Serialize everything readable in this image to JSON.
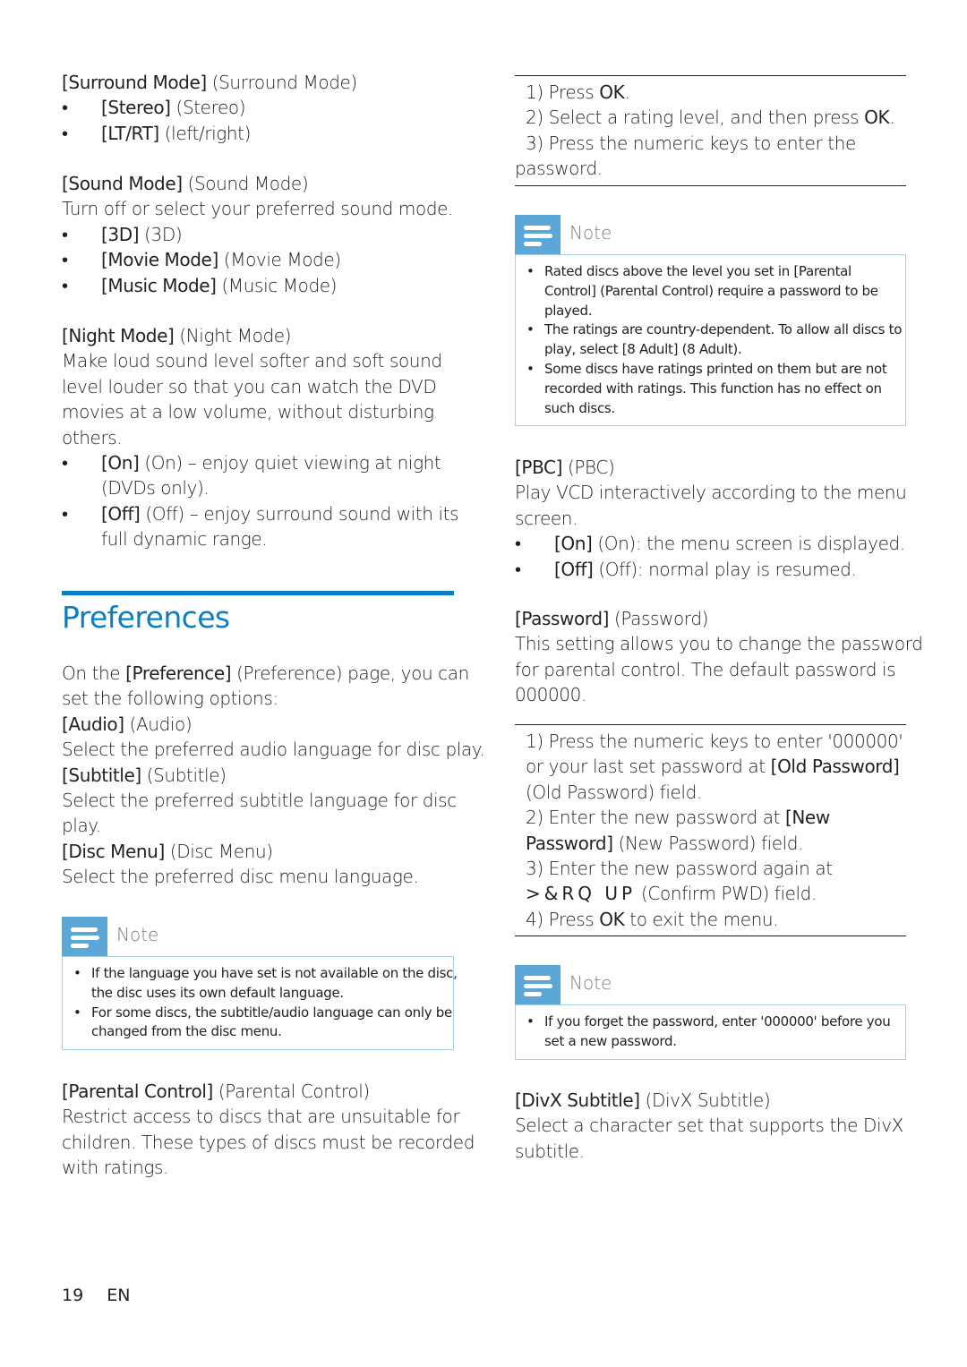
{
  "left": {
    "surround": {
      "label": "[Surround Mode]",
      "desc": " (Surround Mode)",
      "options": [
        {
          "label": "[Stereo]",
          "desc": " (Stereo)"
        },
        {
          "label": "[LT/RT]",
          "desc": " (left/right)"
        }
      ]
    },
    "sound": {
      "label": "[Sound Mode]",
      "desc": " (Sound Mode)",
      "text": "Turn off or select your preferred sound mode.",
      "options": [
        {
          "label": "[3D]",
          "desc": " (3D)"
        },
        {
          "label": "[Movie Mode]",
          "desc": " (Movie Mode)"
        },
        {
          "label": "[Music Mode]",
          "desc": " (Music Mode)"
        }
      ]
    },
    "night": {
      "label": "[Night Mode]",
      "desc": " (Night Mode)",
      "text_lines": [
        "Make loud sound level softer and soft sound",
        "level louder so that you can watch the DVD",
        "movies at a low volume, without disturbing",
        "others."
      ],
      "options": [
        {
          "label": "[On]",
          "desc": " (On) – enjoy quiet viewing at night",
          "desc2": "(DVDs only)."
        },
        {
          "label": "[Off]",
          "desc": " (Off) – enjoy surround sound with its",
          "desc2": "full dynamic range."
        }
      ]
    },
    "preferences": {
      "heading": "Preferences",
      "intro_pre": "On the ",
      "intro_bold": "[Preference]",
      "intro_post": " (Preference) page, you can",
      "intro_line2": "set the following options:",
      "audio": {
        "label": "[Audio]",
        "desc": " (Audio)",
        "text": "Select the preferred audio language for disc play."
      },
      "subtitle": {
        "label": "[Subtitle]",
        "desc": " (Subtitle)",
        "text1": "Select the preferred subtitle language for disc",
        "text2": "play."
      },
      "disc_menu": {
        "label": "[Disc Menu]",
        "desc": " (Disc Menu)",
        "text": "Select the preferred disc menu language."
      }
    },
    "note1": {
      "title": "Note",
      "items": [
        {
          "l1": "If the language you have set is not available on the disc,",
          "l2": "the disc uses its own default language."
        },
        {
          "l1": "For some discs, the subtitle/audio language can only be",
          "l2": "changed from the disc menu."
        }
      ]
    },
    "parental": {
      "label": "[Parental Control]",
      "desc": " (Parental Control)",
      "text_lines": [
        "Restrict access to discs that are unsuitable for",
        "children. These types of discs must be recorded",
        "with ratings."
      ]
    }
  },
  "right": {
    "steps1": {
      "s1_pre": "1) Press ",
      "s1_bold": "OK",
      "s1_post": ".",
      "s2_pre": "2) Select a rating level, and then press ",
      "s2_bold": "OK",
      "s2_post": ".",
      "s3_l1": "3) Press the numeric keys to enter the",
      "s3_l2": "password."
    },
    "note2": {
      "title": "Note",
      "i1_pre": "Rated discs above the level you set in ",
      "i1_bold1": "[Parental",
      "i1_bold2": "Control]",
      "i1_post": " (Parental Control) require a password to be",
      "i1_l3": "played.",
      "i2_l1": "The ratings are country-dependent. To allow all discs to",
      "i2_pre": "play, select ",
      "i2_bold": "[8 Adult]",
      "i2_post": " (8 Adult).",
      "i3_l1": "Some discs have ratings printed on them but are not",
      "i3_l2": "recorded with ratings. This function has no effect on",
      "i3_l3": "such discs."
    },
    "pbc": {
      "label": "[PBC]",
      "desc": " (PBC)",
      "text1": "Play VCD interactively according to the menu",
      "text2": "screen.",
      "options": [
        {
          "label": "[On]",
          "desc": " (On): the menu screen is displayed."
        },
        {
          "label": "[Off]",
          "desc": " (Off): normal play is resumed."
        }
      ]
    },
    "password": {
      "label": "[Password]",
      "desc": " (Password)",
      "text_lines": [
        "This setting allows you to change the password",
        "for parental control. The default password is",
        "000000."
      ]
    },
    "steps2": {
      "s1_l1": "1) Press the numeric keys to enter '000000'",
      "s1_l2_pre": "or your last set password at ",
      "s1_l2_bold": "[Old Password]",
      "s1_l3": "(Old Password) field.",
      "s2_l1_pre": "2) Enter the new password at ",
      "s2_l1_bold": "[New",
      "s2_l2_bold": "Password]",
      "s2_l2_post": " (New Password) field.",
      "s3_l1": "3) Enter the new password again at",
      "s3_l2_garbled": ">&RQ UP",
      "s3_l2_post": " (Confirm PWD) field.",
      "s4_pre": "4) Press ",
      "s4_bold": "OK",
      "s4_post": " to exit the menu."
    },
    "note3": {
      "title": "Note",
      "l1": "If you forget the password, enter '000000' before you",
      "l2": "set a new password."
    },
    "divx": {
      "label": "[DivX Subtitle]",
      "desc": " (DivX Subtitle)",
      "text1": "Select a character set that supports the DivX",
      "text2": "subtitle."
    }
  },
  "footer": {
    "page_number": "19",
    "language": "EN"
  },
  "colors": {
    "accent": "#0b7dc2",
    "note_icon": "#5aa7d8",
    "note_border": "#a7d0ec",
    "text": "#231f20"
  }
}
